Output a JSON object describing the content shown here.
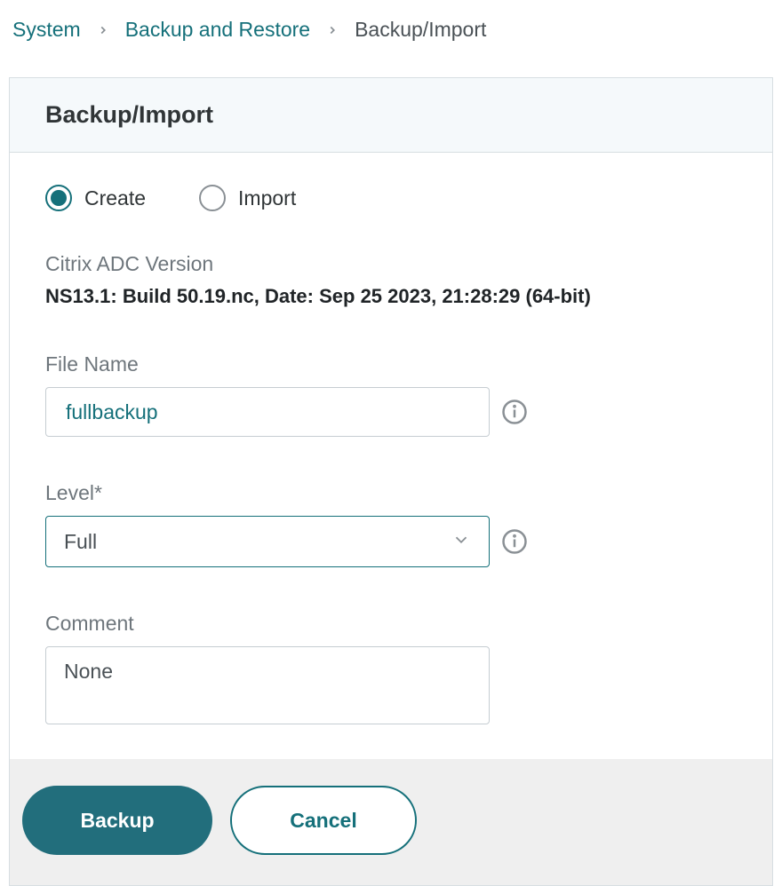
{
  "breadcrumb": {
    "items": [
      {
        "label": "System",
        "link": true
      },
      {
        "label": "Backup and Restore",
        "link": true
      },
      {
        "label": "Backup/Import",
        "link": false
      }
    ]
  },
  "panel": {
    "title": "Backup/Import"
  },
  "mode": {
    "options": [
      {
        "label": "Create",
        "selected": true
      },
      {
        "label": "Import",
        "selected": false
      }
    ]
  },
  "version": {
    "label": "Citrix ADC Version",
    "value": "NS13.1: Build 50.19.nc, Date: Sep 25 2023, 21:28:29   (64-bit)"
  },
  "fileName": {
    "label": "File Name",
    "value": "fullbackup"
  },
  "level": {
    "label": "Level*",
    "value": "Full"
  },
  "comment": {
    "label": "Comment",
    "value": "None"
  },
  "actions": {
    "primary": "Backup",
    "secondary": "Cancel"
  }
}
